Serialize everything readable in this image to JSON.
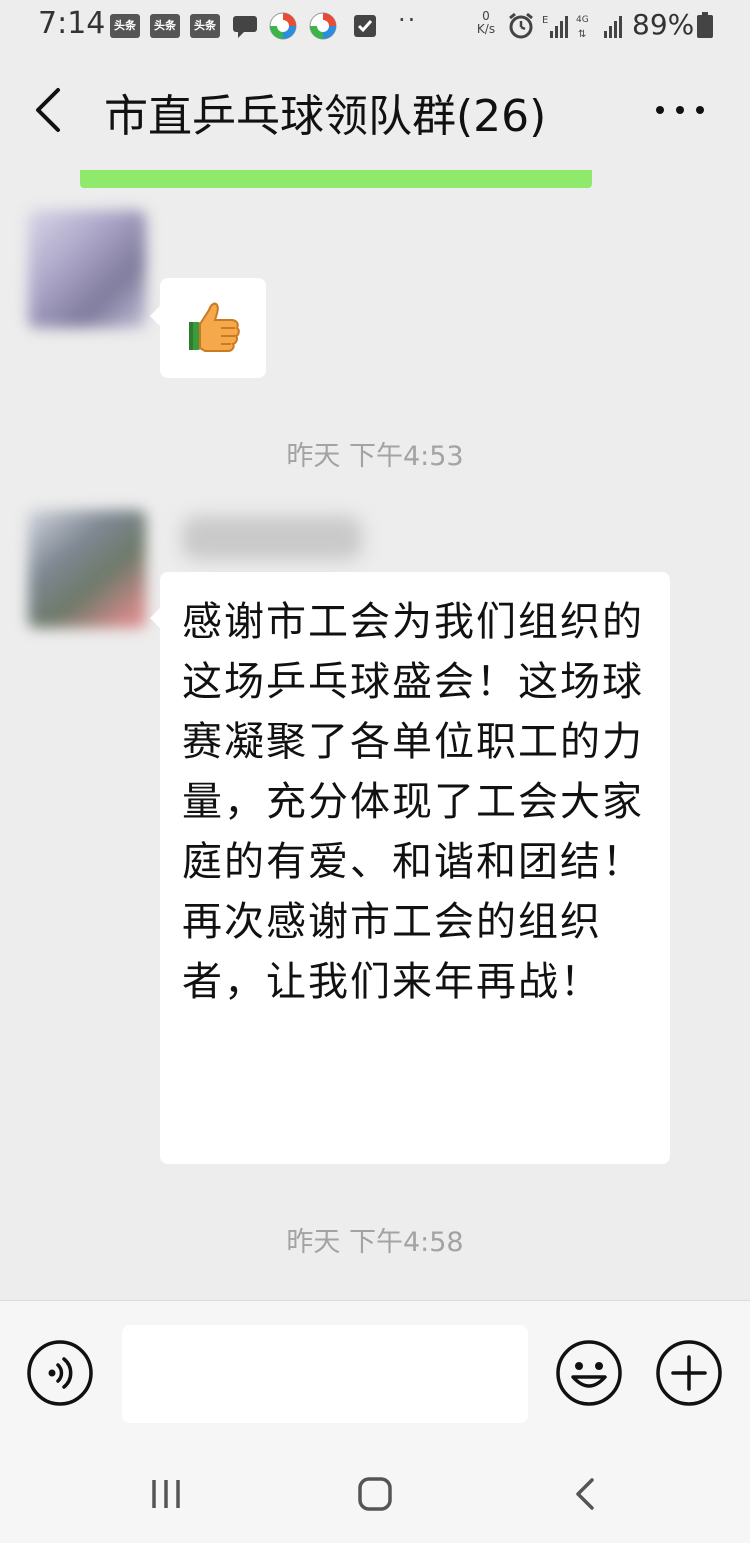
{
  "status_bar": {
    "time": "7:14",
    "app_icon_label": "头条",
    "net_speed_value": "0",
    "net_speed_unit": "K/s",
    "battery_percent": "89%"
  },
  "header": {
    "title": "市直乒乓球领队群(26)"
  },
  "messages": [
    {
      "type": "emoji",
      "emoji": "thumbs-up"
    },
    {
      "type": "timestamp",
      "text": "昨天 下午4:53"
    },
    {
      "type": "text",
      "text": "感谢市工会为我们组织的这场乒乓球盛会！这场球赛凝聚了各单位职工的力量，充分体现了工会大家庭的有爱、和谐和团结！再次感谢市工会的组织者，让我们来年再战！"
    },
    {
      "type": "timestamp",
      "text": "昨天 下午4:58"
    }
  ],
  "input_bar": {
    "value": ""
  },
  "colors": {
    "background": "#ededed",
    "bubble": "#ffffff",
    "accent_strip": "#8fe96a",
    "timestamp": "#a3a3a3"
  }
}
